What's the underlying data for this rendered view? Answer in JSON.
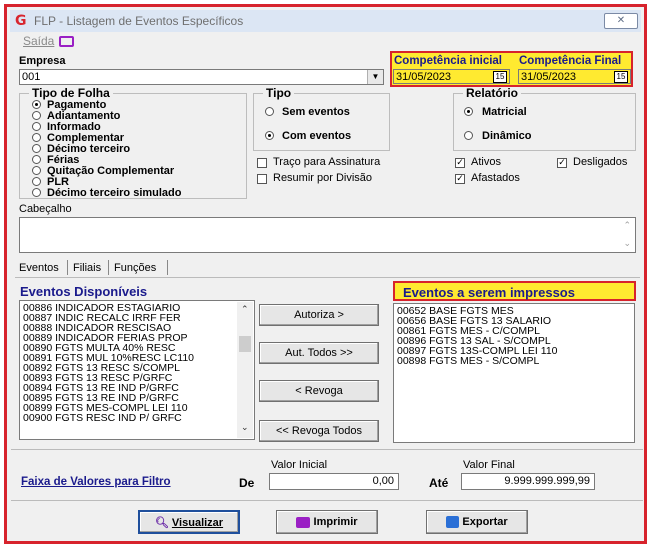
{
  "window": {
    "title": "FLP - Listagem de Eventos Específicos",
    "logo": "G",
    "close": "✕"
  },
  "menu": {
    "saida": "Saída"
  },
  "empresa": {
    "label": "Empresa",
    "value": "001"
  },
  "competencia": {
    "inicial_label": "Competência inicial",
    "inicial_value": "31/05/2023",
    "final_label": "Competência Final",
    "final_value": "31/05/2023",
    "calendar": "15"
  },
  "tipo_folha": {
    "title": "Tipo de Folha",
    "options": [
      "Pagamento",
      "Adiantamento",
      "Informado",
      "Complementar",
      "Décimo terceiro",
      "Férias",
      "Quitação Complementar",
      "PLR",
      "Décimo terceiro simulado"
    ],
    "selected": "Pagamento"
  },
  "tipo": {
    "title": "Tipo",
    "options": [
      "Sem eventos",
      "Com eventos"
    ],
    "selected": "Com eventos"
  },
  "relatorio": {
    "title": "Relatório",
    "options": [
      "Matricial",
      "Dinâmico"
    ],
    "selected": "Matricial"
  },
  "checks": {
    "traco": "Traço para Assinatura",
    "resumir": "Resumir por Divisão",
    "ativos": "Ativos",
    "afastados": "Afastados",
    "desligados": "Desligados"
  },
  "cabecalho": {
    "label": "Cabeçalho"
  },
  "tabs": [
    "Eventos",
    "Filiais",
    "Funções"
  ],
  "eventos_disponiveis": {
    "title": "Eventos Disponíveis",
    "items": [
      "00886 INDICADOR ESTAGIARIO",
      "00887 INDIC RECALC IRRF FER",
      "00888 INDICADOR RESCISAO",
      "00889 INDICADOR FERIAS PROP",
      "00890 FGTS MULTA 40% RESC",
      "00891 FGTS MUL 10%RESC LC110",
      "00892 FGTS 13 RESC S/COMPL",
      "00893 FGTS 13 RESC P/GRFC",
      "00894 FGTS 13 RE IND P/GRFC",
      "00895 FGTS 13 RE IND P/GRFC",
      "00899 FGTS MES-COMPL LEI 110",
      "00900 FGTS RESC IND P/ GRFC"
    ]
  },
  "eventos_impressos": {
    "title": "Eventos a serem impressos",
    "items": [
      "00652 BASE FGTS MES",
      "00656 BASE FGTS 13 SALARIO",
      "00861 FGTS MES - C/COMPL",
      "00896 FGTS 13 SAL - S/COMPL",
      "00897 FGTS 13S-COMPL LEI 110",
      "00898 FGTS MES - S/COMPL"
    ]
  },
  "buttons": {
    "autoriza": "Autoriza >",
    "aut_todos": "Aut. Todos >>",
    "revoga": "< Revoga",
    "revoga_todos": "<< Revoga Todos",
    "visualizar": "Visualizar",
    "imprimir": "Imprimir",
    "exportar": "Exportar"
  },
  "filtro": {
    "label": "Faixa de Valores para Filtro",
    "de": "De",
    "ate": "Até",
    "valor_inicial_label": "Valor Inicial",
    "valor_inicial": "0,00",
    "valor_final_label": "Valor Final",
    "valor_final": "9.999.999.999,99"
  },
  "colors": {
    "highlight": "#ffea30",
    "border_red": "#d7232c",
    "list_title": "#1a1a8c"
  }
}
